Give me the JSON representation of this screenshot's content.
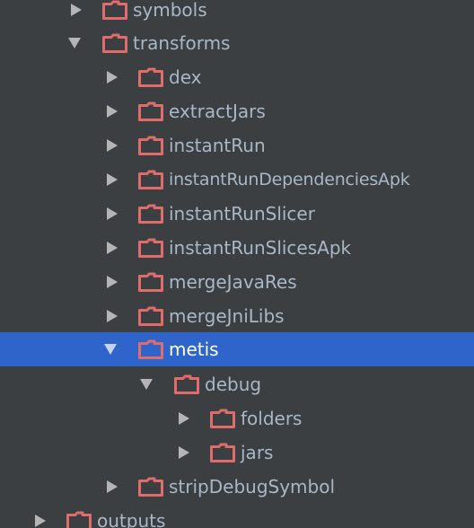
{
  "colors": {
    "background": "#3c3f41",
    "selection": "#2f65ca",
    "folder": "#e06c6c",
    "arrow": "#b5b5b5",
    "text": "#a9b7c6",
    "selected_text": "#ffffff"
  },
  "tree": {
    "items": [
      {
        "label": "symbols",
        "expanded": false,
        "icon": "folder-icon"
      },
      {
        "label": "transforms",
        "expanded": true,
        "icon": "folder-icon"
      },
      {
        "label": "dex",
        "expanded": false,
        "icon": "folder-icon"
      },
      {
        "label": "extractJars",
        "expanded": false,
        "icon": "folder-icon"
      },
      {
        "label": "instantRun",
        "expanded": false,
        "icon": "folder-icon"
      },
      {
        "label": "instantRunDependenciesApk",
        "expanded": false,
        "icon": "folder-icon"
      },
      {
        "label": "instantRunSlicer",
        "expanded": false,
        "icon": "folder-icon"
      },
      {
        "label": "instantRunSlicesApk",
        "expanded": false,
        "icon": "folder-icon"
      },
      {
        "label": "mergeJavaRes",
        "expanded": false,
        "icon": "folder-icon"
      },
      {
        "label": "mergeJniLibs",
        "expanded": false,
        "icon": "folder-icon"
      },
      {
        "label": "metis",
        "expanded": true,
        "selected": true,
        "icon": "folder-icon"
      },
      {
        "label": "debug",
        "expanded": true,
        "icon": "folder-icon"
      },
      {
        "label": "folders",
        "expanded": false,
        "icon": "folder-icon"
      },
      {
        "label": "jars",
        "expanded": false,
        "icon": "folder-icon"
      },
      {
        "label": "stripDebugSymbol",
        "expanded": false,
        "icon": "folder-icon"
      },
      {
        "label": "outputs",
        "expanded": false,
        "icon": "folder-icon"
      }
    ]
  }
}
